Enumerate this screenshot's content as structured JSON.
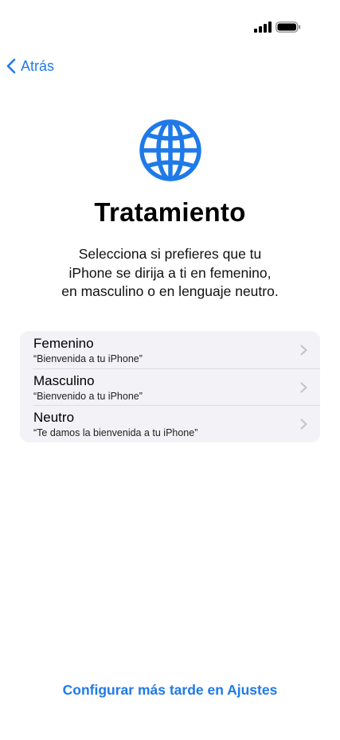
{
  "colors": {
    "accent": "#1f7ae8",
    "list_background": "#f2f2f7",
    "chevron": "#c4c4c7"
  },
  "status_bar": {
    "icons": [
      "cellular-signal-icon",
      "battery-icon"
    ]
  },
  "nav": {
    "back_label": "Atrás",
    "back_icon": "chevron-left-icon"
  },
  "header": {
    "icon": "globe-icon",
    "title": "Tratamiento",
    "subtitle_lines": [
      "Selecciona si prefieres que tu",
      "iPhone se dirija a ti en femenino,",
      "en masculino o en lenguaje neutro."
    ]
  },
  "options": [
    {
      "title": "Femenino",
      "subtitle": "“Bienvenida a tu iPhone”"
    },
    {
      "title": "Masculino",
      "subtitle": "“Bienvenido a tu iPhone”"
    },
    {
      "title": "Neutro",
      "subtitle": "“Te damos la bienvenida a tu iPhone”"
    }
  ],
  "footer": {
    "later_label": "Configurar más tarde en Ajustes"
  }
}
